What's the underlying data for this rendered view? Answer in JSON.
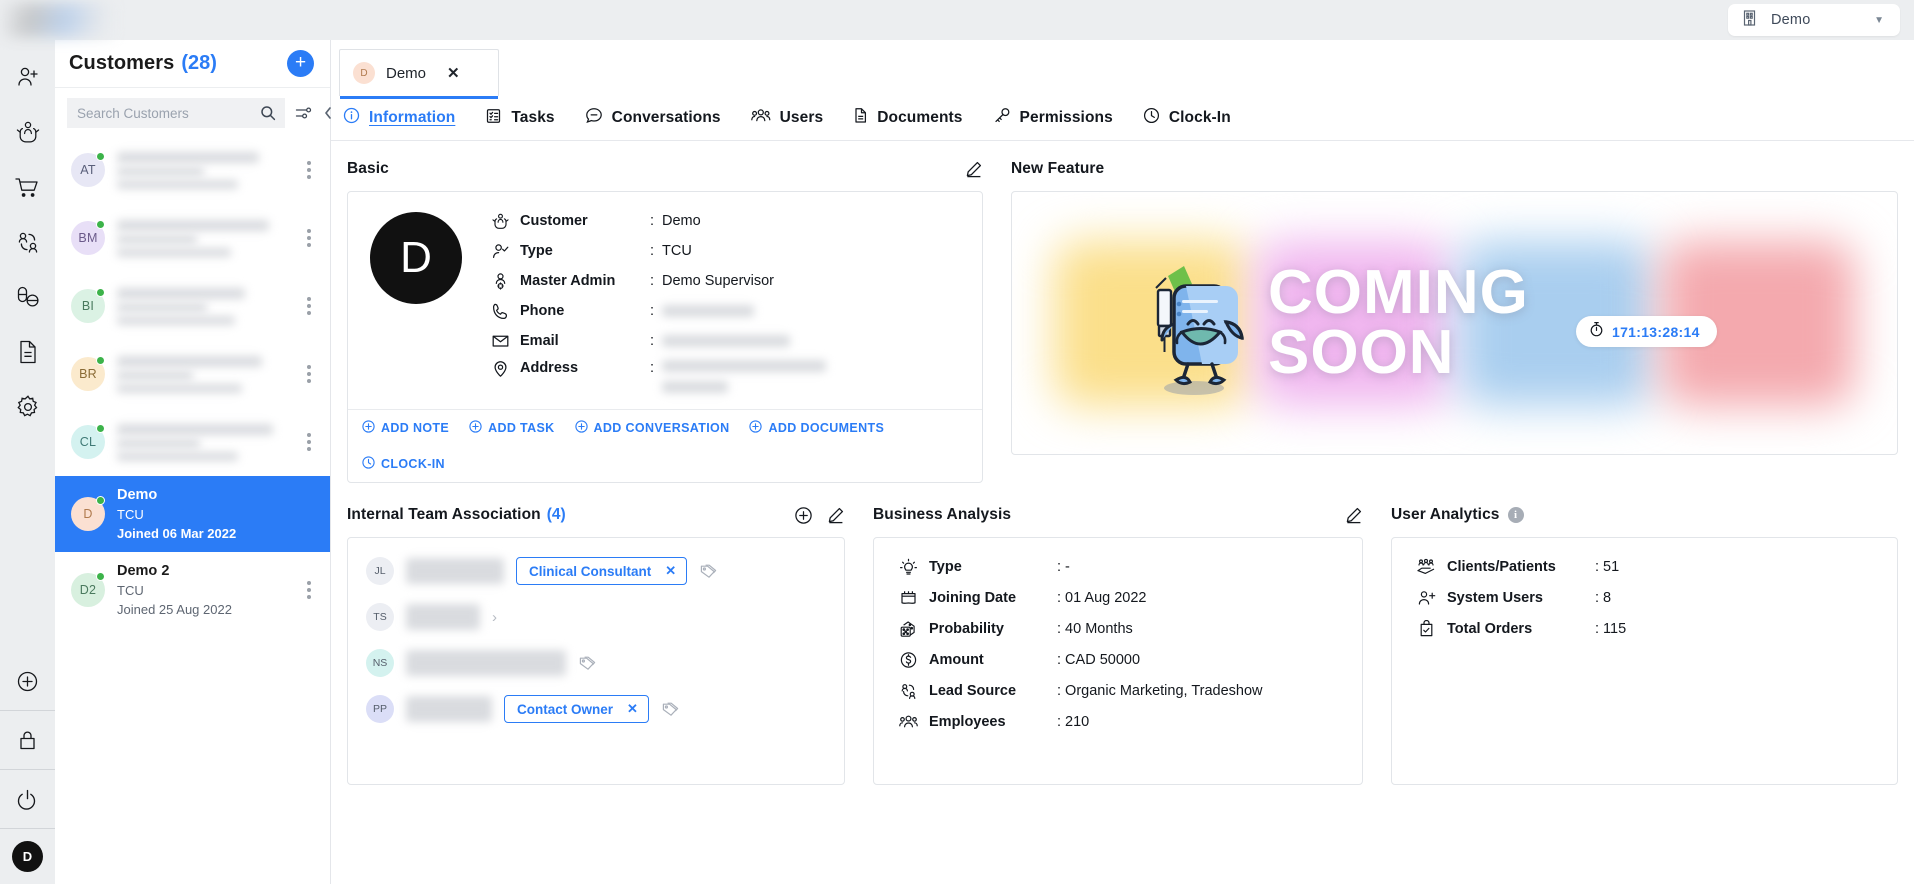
{
  "topbar": {
    "logo": "logo-blurred",
    "org": {
      "label": "Demo",
      "icon": "building-icon",
      "caret": "▼"
    }
  },
  "rail": {
    "top_items": [
      {
        "name": "add-user",
        "icon": "user-plus-icon"
      },
      {
        "name": "care",
        "icon": "hands-care-icon"
      },
      {
        "name": "orders",
        "icon": "shopping-cart-icon"
      },
      {
        "name": "contacts",
        "icon": "users-network-icon"
      },
      {
        "name": "medication",
        "icon": "pills-icon"
      },
      {
        "name": "documents",
        "icon": "document-icon"
      },
      {
        "name": "settings",
        "icon": "gear-icon"
      }
    ],
    "bottom_items": [
      {
        "name": "add",
        "icon": "plus-circle-icon"
      },
      {
        "name": "lock",
        "icon": "lock-icon"
      },
      {
        "name": "power",
        "icon": "power-icon"
      }
    ],
    "avatar_initial": "D"
  },
  "list": {
    "title": "Customers",
    "count": "(28)",
    "add_button": "+",
    "search": {
      "placeholder": "Search Customers",
      "value": ""
    },
    "filter_icon": "filter-sliders-icon",
    "collapse_icon": "chevron-double-left-icon",
    "customers": [
      {
        "initials": "AT",
        "name": "",
        "type": "",
        "joined": "",
        "redacted": true,
        "selected": false,
        "online": true,
        "bg": "#e7e7f5",
        "fg": "#5a5f7a"
      },
      {
        "initials": "BM",
        "name": "",
        "type": "",
        "joined": "",
        "redacted": true,
        "selected": false,
        "online": true,
        "bg": "#e8dff7",
        "fg": "#6b5a8a"
      },
      {
        "initials": "BI",
        "name": "",
        "type": "",
        "joined": "",
        "redacted": true,
        "selected": false,
        "online": true,
        "bg": "#dbf2e4",
        "fg": "#4a7a5e"
      },
      {
        "initials": "BR",
        "name": "",
        "type": "",
        "joined": "",
        "redacted": true,
        "selected": false,
        "online": true,
        "bg": "#fbeacd",
        "fg": "#8a6b35"
      },
      {
        "initials": "CL",
        "name": "",
        "type": "",
        "joined": "",
        "redacted": true,
        "selected": false,
        "online": true,
        "bg": "#d4f2f0",
        "fg": "#3f7a76"
      },
      {
        "initials": "D",
        "name": "Demo",
        "type": "TCU",
        "joined": "Joined 06 Mar 2022",
        "redacted": false,
        "selected": true,
        "online": true,
        "bg": "#fbe0d2",
        "fg": "#b07a4e"
      },
      {
        "initials": "D2",
        "name": "Demo 2",
        "type": "TCU",
        "joined": "Joined 25 Aug 2022",
        "redacted": false,
        "selected": false,
        "online": true,
        "bg": "#d8f0df",
        "fg": "#4a7a5e"
      }
    ]
  },
  "doc_tab": {
    "initial": "D",
    "label": "Demo",
    "close": "✕"
  },
  "nav_tabs": [
    {
      "label": "Information",
      "icon": "info-circle-icon",
      "active": true
    },
    {
      "label": "Tasks",
      "icon": "tasklist-icon",
      "active": false
    },
    {
      "label": "Conversations",
      "icon": "chat-bubble-icon",
      "active": false
    },
    {
      "label": "Users",
      "icon": "users-group-icon",
      "active": false
    },
    {
      "label": "Documents",
      "icon": "file-icon",
      "active": false
    },
    {
      "label": "Permissions",
      "icon": "key-icon",
      "active": false
    },
    {
      "label": "Clock-In",
      "icon": "clock-icon",
      "active": false
    }
  ],
  "basic": {
    "title": "Basic",
    "edit_icon": "pencil-icon",
    "avatar_initial": "D",
    "fields": [
      {
        "icon": "hands-care-icon",
        "key": "Customer",
        "value": "Demo",
        "redacted": false
      },
      {
        "icon": "user-check-icon",
        "key": "Type",
        "value": "TCU",
        "redacted": false
      },
      {
        "icon": "admin-icon",
        "key": "Master Admin",
        "value": "Demo Supervisor",
        "redacted": false
      },
      {
        "icon": "phone-icon",
        "key": "Phone",
        "value": "",
        "redacted": true
      },
      {
        "icon": "envelope-icon",
        "key": "Email",
        "value": "",
        "redacted": true
      },
      {
        "icon": "location-icon",
        "key": "Address",
        "value": "",
        "redacted": true
      }
    ],
    "actions": [
      {
        "label": "ADD NOTE",
        "icon": "plus-circle-icon"
      },
      {
        "label": "ADD TASK",
        "icon": "plus-circle-icon"
      },
      {
        "label": "ADD CONVERSATION",
        "icon": "plus-circle-icon"
      },
      {
        "label": "ADD DOCUMENTS",
        "icon": "plus-circle-icon"
      },
      {
        "label": "CLOCK-IN",
        "icon": "clock-icon"
      }
    ]
  },
  "new_feature": {
    "title": "New Feature",
    "headline_line1": "COMING",
    "headline_line2": "SOON",
    "timer": "171:13:28:14",
    "timer_icon": "stopwatch-icon",
    "blob_colors": [
      "#fbdf8a",
      "#f0b6ef",
      "#a9ceef",
      "#f4a9ae"
    ]
  },
  "team": {
    "title": "Internal Team Association",
    "count": "(4)",
    "add_icon": "plus-circle-icon",
    "edit_icon": "pencil-icon",
    "members": [
      {
        "initials": "JL",
        "bg": "#eceef3",
        "name": "",
        "chip": "Clinical Consultant",
        "chip_close": "✕",
        "tag_icon": "tags-icon",
        "chevron": false
      },
      {
        "initials": "TS",
        "bg": "#eceef3",
        "name": "",
        "chip": "",
        "chip_close": "",
        "tag_icon": "",
        "chevron": true
      },
      {
        "initials": "NS",
        "bg": "#d4f2ef",
        "name": "",
        "chip": "",
        "chip_close": "",
        "tag_icon": "tags-icon",
        "chevron": false
      },
      {
        "initials": "PP",
        "bg": "#dbdef7",
        "name": "",
        "chip": "Contact Owner",
        "chip_close": "✕",
        "tag_icon": "tags-icon",
        "chevron": false
      }
    ]
  },
  "business": {
    "title": "Business Analysis",
    "edit_icon": "pencil-icon",
    "fields": [
      {
        "icon": "lightbulb-icon",
        "key": "Type",
        "value": ": -"
      },
      {
        "icon": "calendar-icon",
        "key": "Joining Date",
        "value": ": 01 Aug 2022"
      },
      {
        "icon": "dice-icon",
        "key": "Probability",
        "value": ": 40 Months"
      },
      {
        "icon": "dollar-circle-icon",
        "key": "Amount",
        "value": ": CAD 50000"
      },
      {
        "icon": "users-network-icon",
        "key": "Lead Source",
        "value": ": Organic Marketing, Tradeshow"
      },
      {
        "icon": "users-group-icon",
        "key": "Employees",
        "value": ": 210"
      }
    ]
  },
  "user_analytics": {
    "title": "User Analytics",
    "info_icon": "info-icon",
    "fields": [
      {
        "icon": "audience-hand-icon",
        "key": "Clients/Patients",
        "value": ": 51"
      },
      {
        "icon": "user-plus-icon",
        "key": "System Users",
        "value": ": 8"
      },
      {
        "icon": "order-bag-icon",
        "key": "Total Orders",
        "value": ": 115"
      }
    ]
  },
  "colors": {
    "accent": "#2b7cf6",
    "online": "#3cb34a",
    "rail_bg": "#eceef0"
  }
}
